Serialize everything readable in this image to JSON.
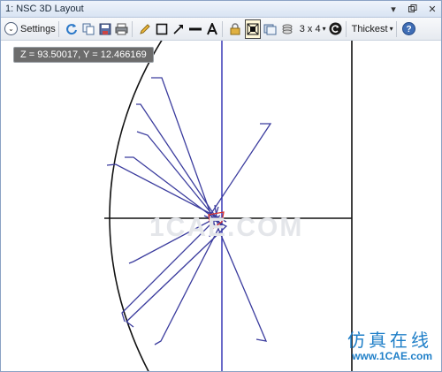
{
  "window": {
    "title": "1: NSC 3D Layout"
  },
  "titlebar_controls": {
    "menu_icon": "chevron-down-icon",
    "restore_icon": "restore-icon",
    "close_icon": "close-icon"
  },
  "toolbar": {
    "settings_label": "Settings",
    "layout_grid_label": "3 x 4",
    "line_thickness_label": "Thickest",
    "icons": [
      "refresh-icon",
      "copy-icon",
      "save-icon",
      "print-icon",
      "pencil-icon",
      "rectangle-icon",
      "arrow-icon",
      "line-icon",
      "text-icon",
      "lock-icon",
      "fit-view-icon",
      "window-icon",
      "layers-icon",
      "rotate-icon",
      "help-icon"
    ]
  },
  "tooltip": {
    "text": "Z = 93.50017, Y = 12.466169"
  },
  "watermark": {
    "text": "1CAE.COM"
  },
  "brand": {
    "chinese": "仿真在线",
    "url": "www.1CAE.com"
  },
  "colors": {
    "ray": "#3b3c9e",
    "axis": "#1a1a1a",
    "optical_axis": "#2a2ab0",
    "detector": "#d63030",
    "brand": "#1f7fc8"
  }
}
